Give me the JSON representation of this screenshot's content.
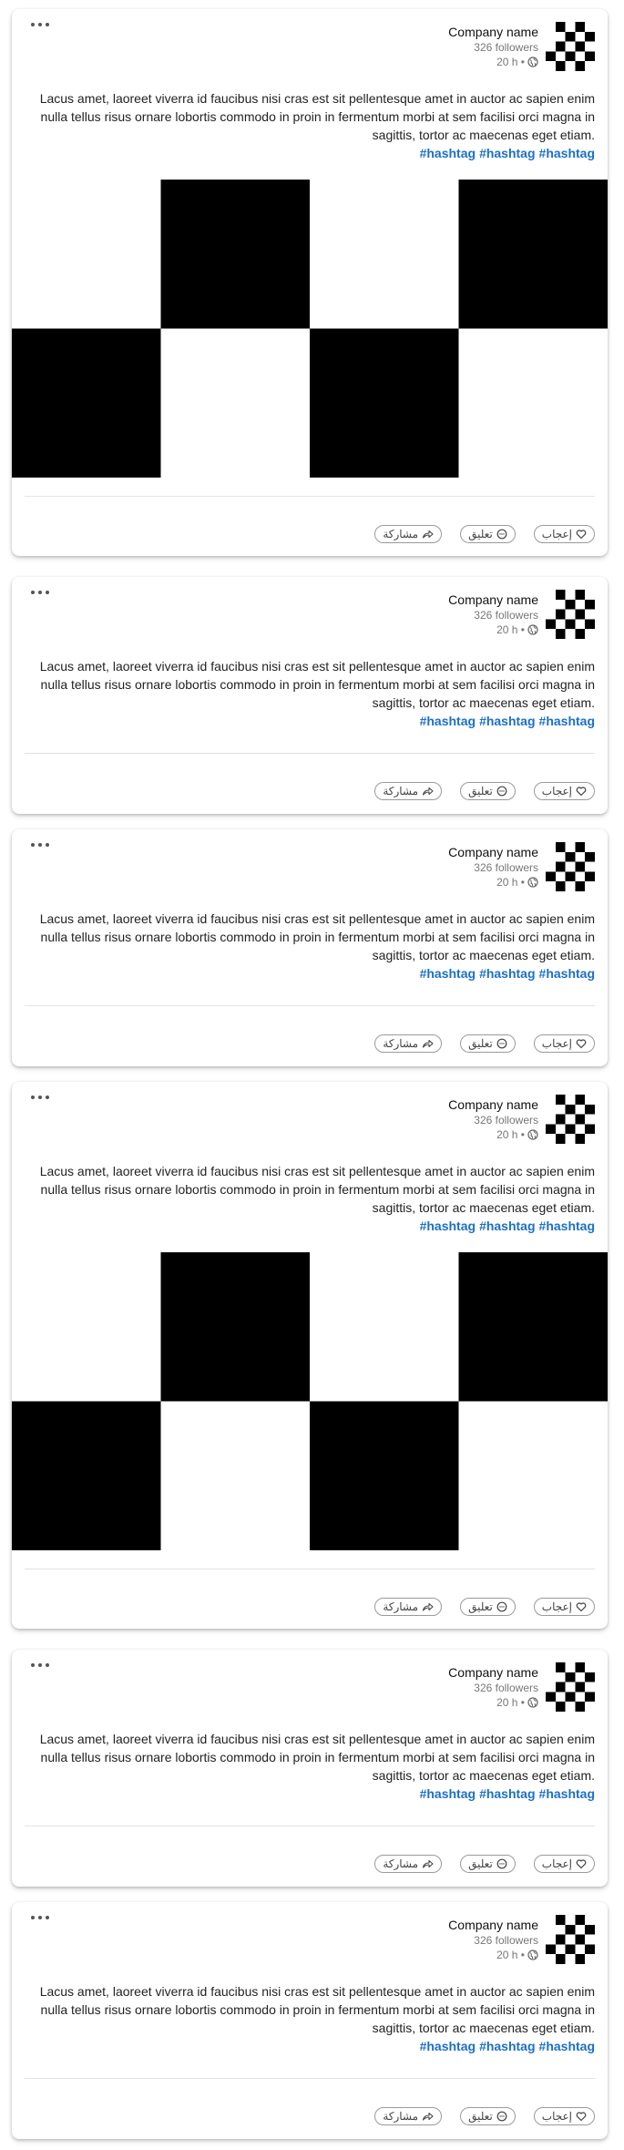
{
  "posts": [
    {
      "company_name": "Company name",
      "followers": "326 followers",
      "time": "20 h •",
      "body": "Lacus amet, laoreet viverra id faucibus nisi cras est sit pellentesque amet in auctor ac sapien enim nulla tellus risus ornare lobortis commodo in proin in fermentum morbi at sem facilisi orci magna in sagittis, tortor ac maecenas eget etiam.",
      "hashtags": [
        "#hashtag",
        "#hashtag",
        "#hashtag"
      ],
      "has_image": true,
      "actions": {
        "like": "إعجاب",
        "comment": "تعليق",
        "share": "مشاركة"
      }
    },
    {
      "company_name": "Company name",
      "followers": "326 followers",
      "time": "20 h •",
      "body": "Lacus amet, laoreet viverra id faucibus nisi cras est sit pellentesque amet in auctor ac sapien enim nulla tellus risus ornare lobortis commodo in proin in fermentum morbi at sem facilisi orci magna in sagittis, tortor ac maecenas eget etiam.",
      "hashtags": [
        "#hashtag",
        "#hashtag",
        "#hashtag"
      ],
      "has_image": false,
      "actions": {
        "like": "إعجاب",
        "comment": "تعليق",
        "share": "مشاركة"
      }
    },
    {
      "company_name": "Company name",
      "followers": "326 followers",
      "time": "20 h •",
      "body": "Lacus amet, laoreet viverra id faucibus nisi cras est sit pellentesque amet in auctor ac sapien enim nulla tellus risus ornare lobortis commodo in proin in fermentum morbi at sem facilisi orci magna in sagittis, tortor ac maecenas eget etiam.",
      "hashtags": [
        "#hashtag",
        "#hashtag",
        "#hashtag"
      ],
      "has_image": false,
      "actions": {
        "like": "إعجاب",
        "comment": "تعليق",
        "share": "مشاركة"
      }
    },
    {
      "company_name": "Company name",
      "followers": "326 followers",
      "time": "20 h •",
      "body": "Lacus amet, laoreet viverra id faucibus nisi cras est sit pellentesque amet in auctor ac sapien enim nulla tellus risus ornare lobortis commodo in proin in fermentum morbi at sem facilisi orci magna in sagittis, tortor ac maecenas eget etiam.",
      "hashtags": [
        "#hashtag",
        "#hashtag",
        "#hashtag"
      ],
      "has_image": true,
      "actions": {
        "like": "إعجاب",
        "comment": "تعليق",
        "share": "مشاركة"
      }
    },
    {
      "company_name": "Company name",
      "followers": "326 followers",
      "time": "20 h •",
      "body": "Lacus amet, laoreet viverra id faucibus nisi cras est sit pellentesque amet in auctor ac sapien enim nulla tellus risus ornare lobortis commodo in proin in fermentum morbi at sem facilisi orci magna in sagittis, tortor ac maecenas eget etiam.",
      "hashtags": [
        "#hashtag",
        "#hashtag",
        "#hashtag"
      ],
      "has_image": false,
      "actions": {
        "like": "إعجاب",
        "comment": "تعليق",
        "share": "مشاركة"
      }
    },
    {
      "company_name": "Company name",
      "followers": "326 followers",
      "time": "20 h •",
      "body": "Lacus amet, laoreet viverra id faucibus nisi cras est sit pellentesque amet in auctor ac sapien enim nulla tellus risus ornare lobortis commodo in proin in fermentum morbi at sem facilisi orci magna in sagittis, tortor ac maecenas eget etiam.",
      "hashtags": [
        "#hashtag",
        "#hashtag",
        "#hashtag"
      ],
      "has_image": false,
      "actions": {
        "like": "إعجاب",
        "comment": "تعليق",
        "share": "مشاركة"
      }
    }
  ],
  "colors": {
    "hashtag": "#1b6fc9",
    "text": "#222222",
    "muted": "#777777",
    "placeholder_dark": "#000000",
    "placeholder_light": "#ffffff"
  },
  "icons": {
    "menu": "more-horizontal-icon",
    "visibility": "globe-icon",
    "like": "heart-icon",
    "comment": "chat-bubble-icon",
    "share": "share-arrow-icon",
    "avatar": "checkerboard-logo"
  }
}
